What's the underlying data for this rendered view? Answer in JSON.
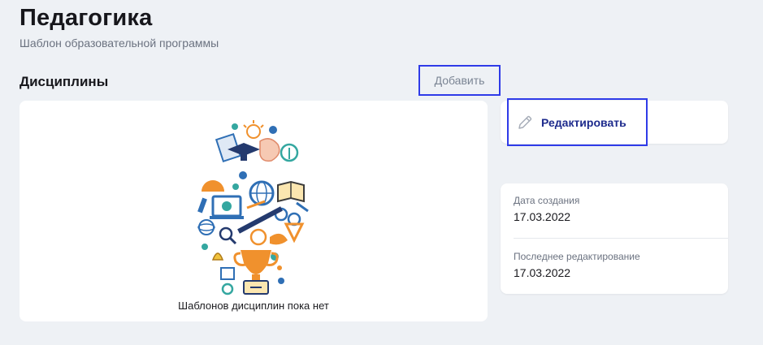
{
  "header": {
    "title": "Педагогика",
    "subtitle": "Шаблон образовательной программы"
  },
  "disciplines": {
    "title": "Дисциплины",
    "add_label": "Добавить",
    "empty_text": "Шаблонов дисциплин пока нет"
  },
  "actions": {
    "edit_label": "Редактировать",
    "edit_icon": "pencil-icon"
  },
  "info": {
    "created_label": "Дата создания",
    "created_value": "17.03.2022",
    "edited_label": "Последнее редактирование",
    "edited_value": "17.03.2022"
  },
  "colors": {
    "background": "#eef1f5",
    "focus_outline": "#2f3be8",
    "link_text": "#1d2a8c",
    "illustration_blue": "#2f6fb5",
    "illustration_orange": "#f0912d",
    "illustration_teal": "#34a7a0"
  }
}
